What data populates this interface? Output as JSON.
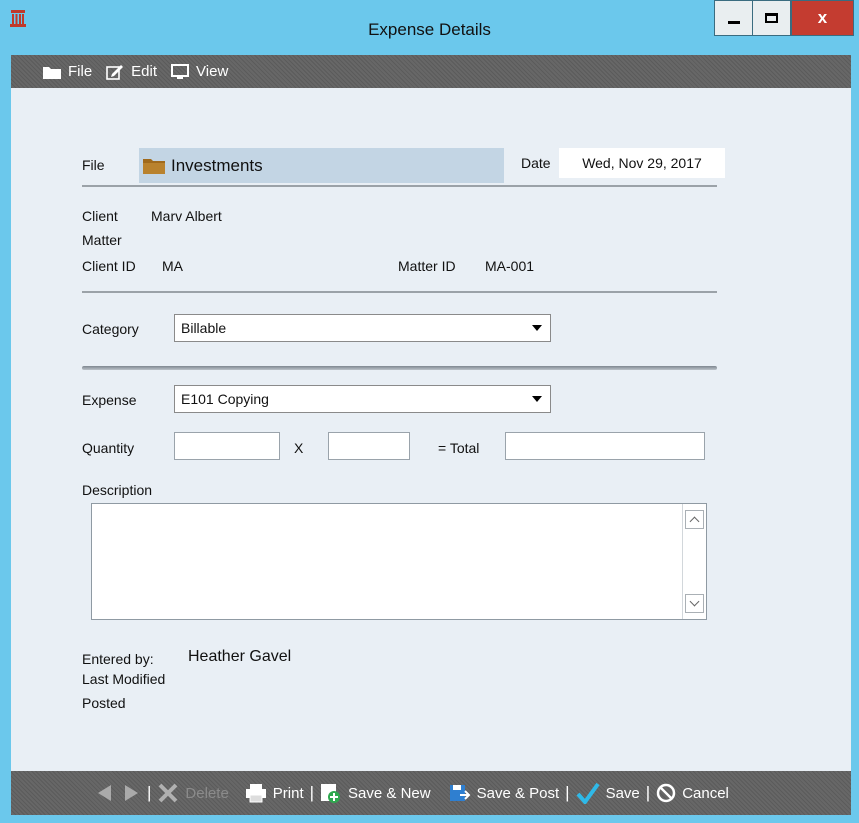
{
  "window": {
    "title": "Expense Details",
    "close_glyph": "x"
  },
  "menu": [
    {
      "label": "File",
      "icon": "folder-icon"
    },
    {
      "label": "Edit",
      "icon": "edit-icon"
    },
    {
      "label": "View",
      "icon": "monitor-icon"
    }
  ],
  "form": {
    "file_label": "File",
    "file_value": "Investments",
    "date_label": "Date",
    "date_value": "Wed, Nov 29, 2017",
    "client_label": "Client",
    "client_value": "Marv Albert",
    "matter_label": "Matter",
    "client_id_label": "Client ID",
    "client_id_value": "MA",
    "matter_id_label": "Matter ID",
    "matter_id_value": "MA-001",
    "category_label": "Category",
    "category_value": "Billable",
    "expense_label": "Expense",
    "expense_value": "E101 Copying",
    "quantity_label": "Quantity",
    "multiply_label": "X",
    "total_label": "= Total",
    "description_label": "Description",
    "entered_by_label": "Entered by:",
    "entered_by_value": "Heather Gavel",
    "last_modified_label": "Last Modified",
    "posted_label": "Posted"
  },
  "bottom": {
    "delete": "Delete",
    "print": "Print",
    "save_new": "Save & New",
    "save_post": "Save & Post",
    "save": "Save",
    "cancel": "Cancel"
  },
  "colors": {
    "title_bar": "#6bc8ec",
    "toolbar": "#5f5f5f",
    "content_bg": "#e9eff5",
    "file_field": "#c3d5e4",
    "close_button": "#c43c30",
    "save_check": "#2fb9e8"
  }
}
